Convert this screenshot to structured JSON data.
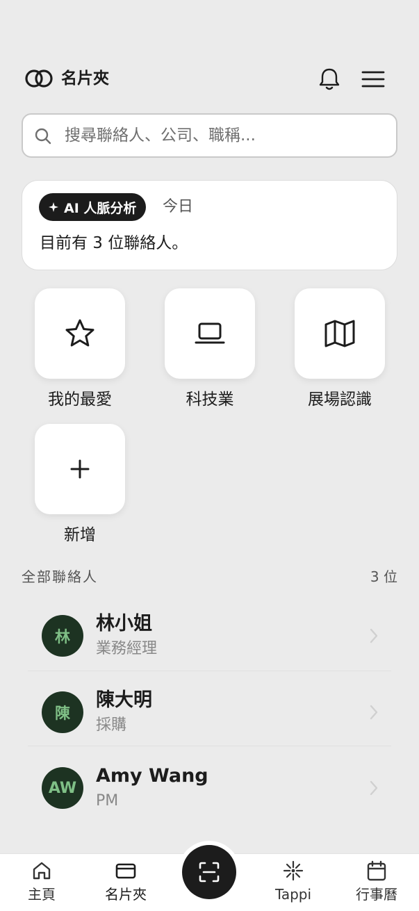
{
  "header": {
    "title": "名片夾",
    "icons": {
      "logo": "logo-rings-icon",
      "notifications": "bell-icon",
      "menu": "hamburger-menu-icon"
    }
  },
  "search": {
    "placeholder": "搜尋聯絡人、公司、職稱...",
    "value": "",
    "icon": "search-icon"
  },
  "ai_card": {
    "badge": "AI 人脈分析",
    "date": "今日",
    "message": "目前有 3 位聯絡人。"
  },
  "categories": [
    {
      "label": "我的最愛",
      "icon": "star-icon"
    },
    {
      "label": "科技業",
      "icon": "laptop-icon"
    },
    {
      "label": "展場認識",
      "icon": "map-icon"
    },
    {
      "label": "新增",
      "icon": "plus-icon"
    }
  ],
  "contacts_section": {
    "title": "全部聯絡人",
    "count": "3 位"
  },
  "contacts": [
    {
      "initials": "林",
      "name": "林小姐",
      "role": "業務經理"
    },
    {
      "initials": "陳",
      "name": "陳大明",
      "role": "採購"
    },
    {
      "initials": "AW",
      "name": "Amy Wang",
      "role": "PM"
    }
  ],
  "bottom_nav": [
    {
      "label": "主頁",
      "icon": "home-icon"
    },
    {
      "label": "名片夾",
      "icon": "card-icon",
      "active": true
    },
    {
      "label": "",
      "icon": "scan-icon"
    },
    {
      "label": "Tappi",
      "icon": "sparkle-icon"
    },
    {
      "label": "行事曆",
      "icon": "calendar-icon"
    }
  ],
  "colors": {
    "background": "#ebebeb",
    "card": "#ffffff",
    "dark": "#1c1c1c",
    "avatar_bg": "#1d3322",
    "avatar_text": "#7fbf86"
  }
}
